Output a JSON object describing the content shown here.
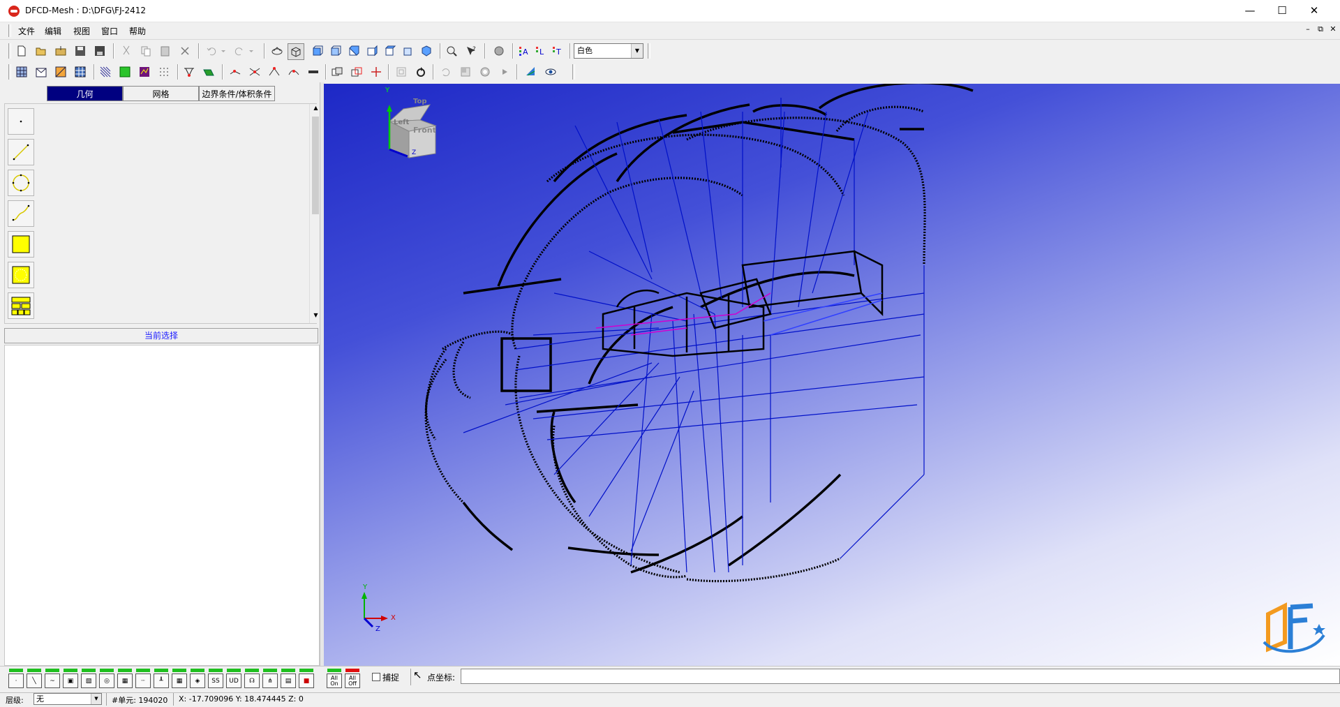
{
  "window": {
    "title": "DFCD-Mesh : D:\\DFG\\FJ-2412",
    "minimize": "—",
    "maximize": "☐",
    "close": "✕"
  },
  "menu": {
    "items": [
      "文件",
      "编辑",
      "视图",
      "窗口",
      "帮助"
    ],
    "mdi_controls": [
      "–",
      "⧉",
      "✕"
    ]
  },
  "toolbar": {
    "color_select": "白色"
  },
  "left_panel": {
    "tabs": [
      "几何",
      "网格",
      "边界条件/体积条件"
    ],
    "active_tab": 0,
    "tools": [
      "point-tool",
      "line-tool",
      "circle-tool",
      "curve-tool",
      "face-tool",
      "circle-face-tool",
      "block-tool"
    ],
    "selection_header": "当前选择"
  },
  "viewport": {
    "view_cube": {
      "top": "Top",
      "left": "Left",
      "front": "Front",
      "y_axis": "Y",
      "z_axis": "Z"
    },
    "triad": {
      "x": "X",
      "y": "Y",
      "z": "Z"
    }
  },
  "bottom_bar": {
    "filters": [
      "·",
      "╲",
      "~",
      "▣",
      "▧",
      "◎",
      "▦",
      "┈",
      "┸",
      "▦",
      "◈",
      "SS",
      "UD",
      "☊",
      "⋔",
      "▤",
      "■"
    ],
    "all_on": "All On",
    "all_off": "All Off",
    "snap_label": "捕捉",
    "point_coord_label": "点坐标:"
  },
  "status": {
    "layer_label": "层级:",
    "layer_value": "无",
    "elements": "#单元: 194020",
    "coords": "X: -17.709096 Y: 18.474445 Z: 0"
  }
}
